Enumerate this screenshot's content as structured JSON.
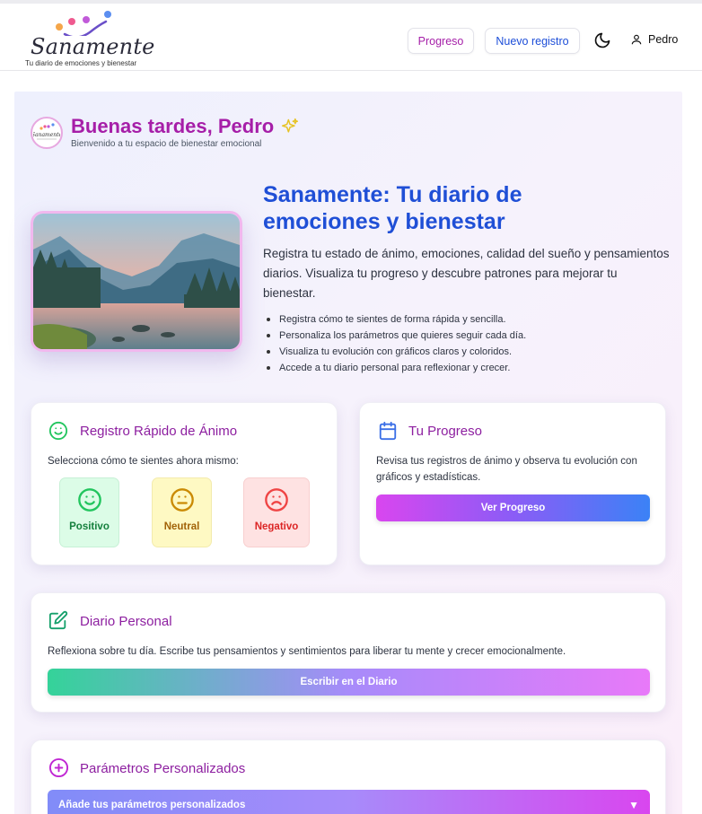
{
  "brand": {
    "name": "Sanamente",
    "tagline": "Tu diario de emociones y bienestar"
  },
  "nav": {
    "progress_label": "Progreso",
    "new_entry_label": "Nuevo registro",
    "theme_icon": "moon-icon",
    "user_icon": "user-icon",
    "user_name": "Pedro"
  },
  "greeting": {
    "title": "Buenas tardes, Pedro",
    "subtitle": "Bienvenido a tu espacio de bienestar emocional",
    "icon": "sparkles-icon"
  },
  "hero": {
    "title": "Sanamente: Tu diario de emociones y bienestar",
    "description": "Registra tu estado de ánimo, emociones, calidad del sueño y pensamientos diarios. Visualiza tu progreso y descubre patrones para mejorar tu bienestar.",
    "bullets": [
      "Registra cómo te sientes de forma rápida y sencilla.",
      "Personaliza los parámetros que quieres seguir cada día.",
      "Visualiza tu evolución con gráficos claros y coloridos.",
      "Accede a tu diario personal para reflexionar y crecer."
    ]
  },
  "quick_mood": {
    "title": "Registro Rápido de Ánimo",
    "prompt": "Selecciona cómo te sientes ahora mismo:",
    "options": [
      {
        "label": "Positivo",
        "icon": "smile-icon"
      },
      {
        "label": "Neutral",
        "icon": "meh-icon"
      },
      {
        "label": "Negativo",
        "icon": "frown-icon"
      }
    ]
  },
  "progress_card": {
    "title": "Tu Progreso",
    "text": "Revisa tus registros de ánimo y observa tu evolución con gráficos y estadísticas.",
    "button": "Ver Progreso"
  },
  "diary_card": {
    "title": "Diario Personal",
    "text": "Reflexiona sobre tu día. Escribe tus pensamientos y sentimientos para liberar tu mente y crecer emocionalmente.",
    "button": "Escribir en el Diario"
  },
  "params_card": {
    "title": "Parámetros Personalizados",
    "dropdown": "Añade tus parámetros personalizados",
    "dropdown_icon": "▼"
  },
  "colors": {
    "accent_purple": "#a61ea8",
    "accent_blue": "#1f4fd6",
    "positive": "#22c55e",
    "neutral": "#ca8a04",
    "negative": "#ef4444"
  }
}
